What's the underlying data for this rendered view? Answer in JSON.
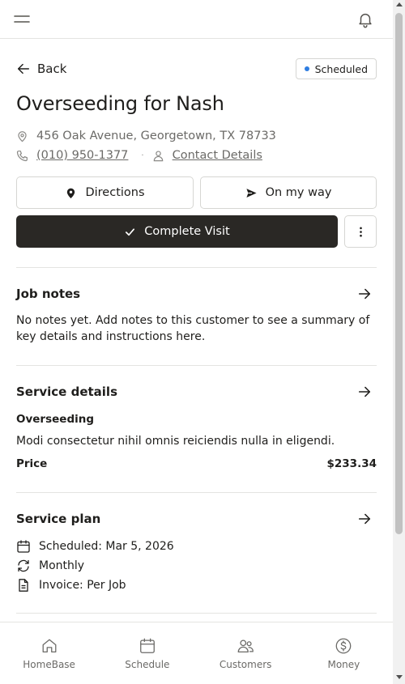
{
  "header": {
    "menu_icon": "hamburger-icon",
    "notifications_icon": "bell-icon"
  },
  "job": {
    "back_label": "Back",
    "status": "Scheduled",
    "status_color": "#2f7de1",
    "title": "Overseeding for Nash",
    "address": "456 Oak Avenue, Georgetown, TX 78733",
    "phone": "(010) 950-1377",
    "separator": "·",
    "contact_label": "Contact Details"
  },
  "actions": {
    "directions": "Directions",
    "on_my_way": "On my way",
    "complete_visit": "Complete Visit",
    "complete_bg": "#2a2825"
  },
  "job_notes": {
    "title": "Job notes",
    "text": "No notes yet. Add notes to this customer to see a summary of key details and instructions here."
  },
  "service_details": {
    "title": "Service details",
    "service_name": "Overseeding",
    "description": "Modi consectetur nihil omnis reiciendis nulla in eligendi.",
    "price_label": "Price",
    "price_value": "$233.34"
  },
  "service_plan": {
    "title": "Service plan",
    "scheduled": "Scheduled: Mar 5, 2026",
    "frequency": "Monthly",
    "invoice": "Invoice: Per Job"
  },
  "bottom_nav": {
    "items": [
      {
        "label": "HomeBase",
        "icon": "home-icon"
      },
      {
        "label": "Schedule",
        "icon": "calendar-icon"
      },
      {
        "label": "Customers",
        "icon": "users-icon"
      },
      {
        "label": "Money",
        "icon": "dollar-icon"
      }
    ]
  }
}
